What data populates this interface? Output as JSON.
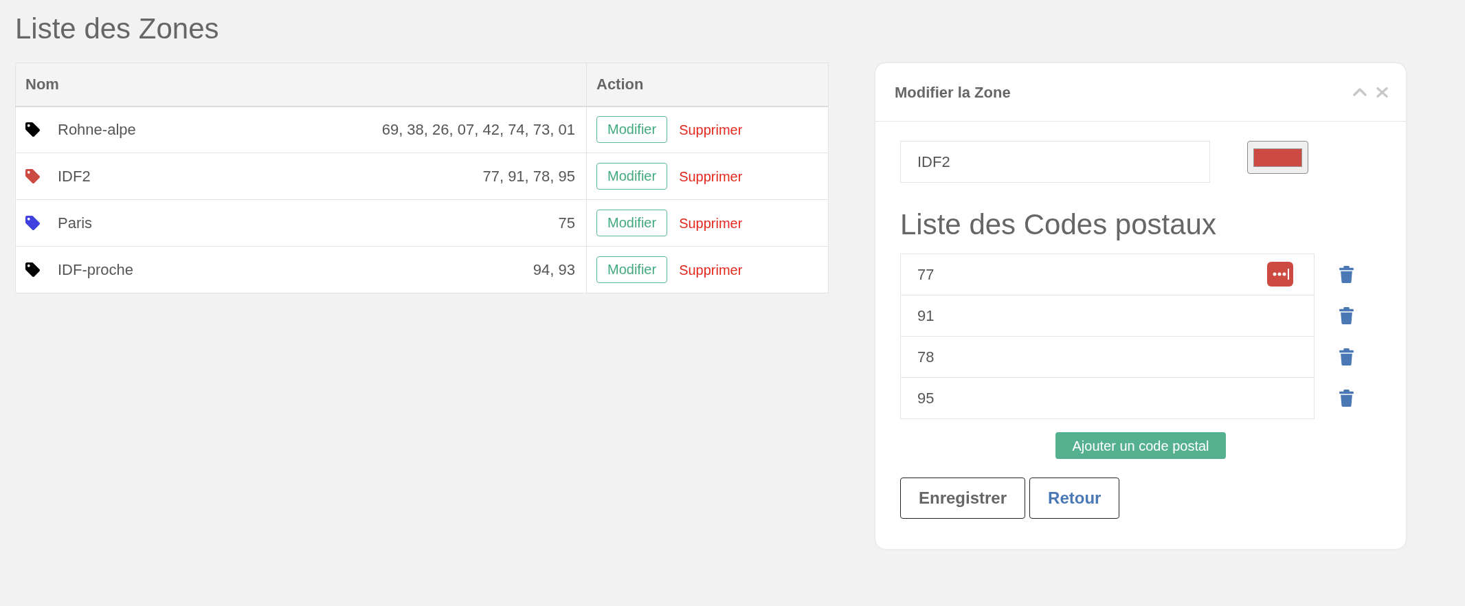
{
  "page_title": "Liste des Zones",
  "table": {
    "columns": [
      "Nom",
      "Action"
    ],
    "rows": [
      {
        "color": "#000000",
        "name": "Rohne-alpe",
        "codes": "69, 38, 26, 07, 42, 74, 73, 01",
        "edit_label": "Modifier",
        "delete_label": "Supprimer"
      },
      {
        "color": "#cc4a41",
        "name": "IDF2",
        "codes": "77, 91, 78, 95",
        "edit_label": "Modifier",
        "delete_label": "Supprimer"
      },
      {
        "color": "#4040e0",
        "name": "Paris",
        "codes": "75",
        "edit_label": "Modifier",
        "delete_label": "Supprimer"
      },
      {
        "color": "#000000",
        "name": "IDF-proche",
        "codes": "94, 93",
        "edit_label": "Modifier",
        "delete_label": "Supprimer"
      }
    ]
  },
  "edit_panel": {
    "title": "Modifier la Zone",
    "name_value": "IDF2",
    "color": "#cc4a41",
    "codes_title": "Liste des Codes postaux",
    "codes": [
      {
        "value": "77",
        "autofill_badge": true
      },
      {
        "value": "91",
        "autofill_badge": false
      },
      {
        "value": "78",
        "autofill_badge": false
      },
      {
        "value": "95",
        "autofill_badge": false
      }
    ],
    "add_button": "Ajouter un code postal",
    "buttons": [
      {
        "label": "Enregistrer",
        "kind": "secondary"
      },
      {
        "label": "Retour",
        "kind": "primary"
      }
    ]
  }
}
